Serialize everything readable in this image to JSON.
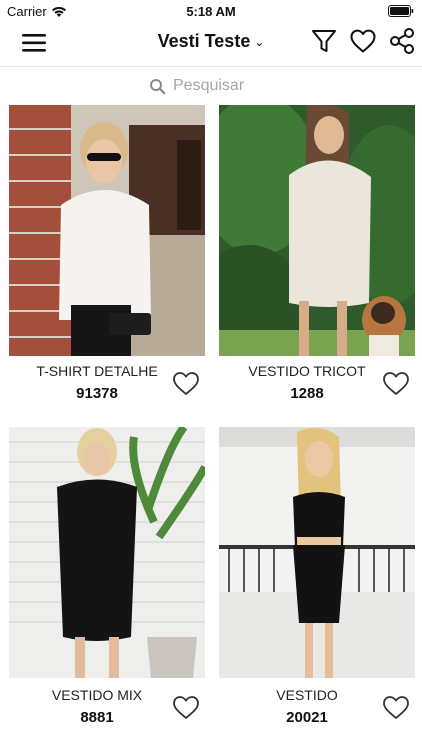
{
  "status": {
    "carrier": "Carrier",
    "time": "5:18 AM"
  },
  "nav": {
    "title": "Vesti Teste",
    "chevron": "⌄"
  },
  "search": {
    "placeholder": "Pesquisar",
    "value": ""
  },
  "products": [
    {
      "name": "T-SHIRT DETALHE",
      "code": "91378"
    },
    {
      "name": "VESTIDO TRICOT",
      "code": "1288"
    },
    {
      "name": "VESTIDO MIX",
      "code": "8881"
    },
    {
      "name": "VESTIDO",
      "code": "20021"
    }
  ]
}
